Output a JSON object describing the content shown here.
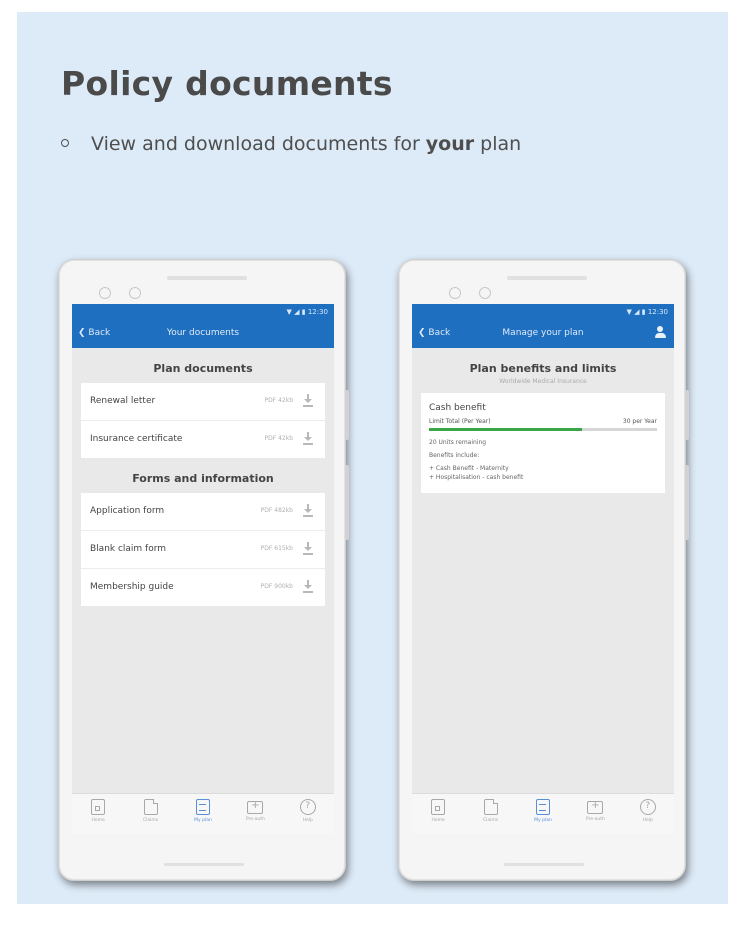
{
  "page": {
    "title": "Policy documents",
    "subtitle_pre": "View and download documents for ",
    "subtitle_bold": "your",
    "subtitle_post": " plan"
  },
  "colors": {
    "panel": "#ddeaf7",
    "app_bar": "#1f6fc0",
    "progress": "#3aa64a",
    "active_tab": "#5a8fd6"
  },
  "status_bar": {
    "time": "12:30"
  },
  "left_phone": {
    "app_bar": {
      "back_label": "Back",
      "title": "Your documents"
    },
    "plan_section": {
      "title": "Plan documents",
      "rows": [
        {
          "label": "Renewal letter",
          "meta": "PDF 42kb"
        },
        {
          "label": "Insurance certificate",
          "meta": "PDF 42kb"
        }
      ]
    },
    "forms_section": {
      "title": "Forms and information",
      "rows": [
        {
          "label": "Application form",
          "meta": "PDF 482kb"
        },
        {
          "label": "Blank claim form",
          "meta": "PDF 615kb"
        },
        {
          "label": "Membership guide",
          "meta": "PDF 900kb"
        }
      ]
    }
  },
  "right_phone": {
    "app_bar": {
      "back_label": "Back",
      "title": "Manage your plan",
      "icon": "user-icon"
    },
    "heading": "Plan benefits and limits",
    "subheading": "Worldwide Medical Insurance",
    "card": {
      "title": "Cash benefit",
      "limit_label": "Limit Total (Per Year)",
      "limit_value": "30 per Year",
      "progress_fraction": 0.67,
      "remaining": "20 Units remaining",
      "benefits_label": "Benefits include:",
      "benefits": [
        "+ Cash Benefit - Maternity",
        "+ Hospitalisation - cash benefit"
      ]
    }
  },
  "tab_bar": {
    "tabs": [
      {
        "label": "Home",
        "icon": "home-icon"
      },
      {
        "label": "Claims",
        "icon": "document-icon"
      },
      {
        "label": "My plan",
        "icon": "plan-icon",
        "active": true
      },
      {
        "label": "Pre-auth",
        "icon": "medical-kit-icon"
      },
      {
        "label": "Help",
        "icon": "help-icon"
      }
    ]
  }
}
